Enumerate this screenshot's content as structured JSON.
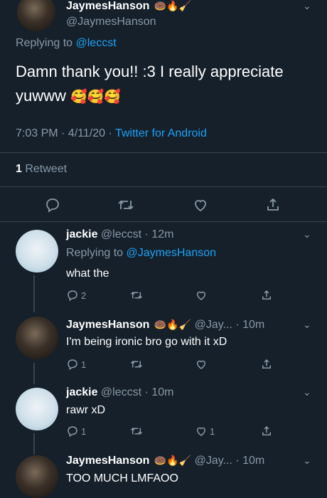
{
  "main_tweet": {
    "name": "JaymesHanson",
    "name_emojis": "🍩🔥🧹",
    "handle": "@JaymesHanson",
    "replying_prefix": "Replying to ",
    "replying_to": "@leccst",
    "text": "Damn thank you!!  :3 I really appreciate yuwww",
    "text_emojis": "🥰🥰🥰",
    "time": "7:03 PM · 4/11/20 · ",
    "client": "Twitter for Android",
    "retweet_count": "1",
    "retweet_label": " Retweet"
  },
  "replies": [
    {
      "name": "jackie",
      "name_emojis": "",
      "handle_time": " @leccst · 12m",
      "replying_prefix": "Replying to ",
      "replying_to": "@JaymesHanson",
      "text": "what the",
      "reply_count": "2",
      "like_count": ""
    },
    {
      "name": "JaymesHanson",
      "name_emojis": "🍩🔥🧹",
      "handle_time": " @Jay... · 10m",
      "text": "I'm being ironic bro go with it xD",
      "reply_count": "1",
      "like_count": ""
    },
    {
      "name": "jackie",
      "name_emojis": "",
      "handle_time": " @leccst · 10m",
      "text": "rawr xD",
      "reply_count": "1",
      "like_count": "1"
    },
    {
      "name": "JaymesHanson",
      "name_emojis": "🍩🔥🧹",
      "handle_time": " @Jay... · 10m",
      "text": "TOO MUCH LMFAOO"
    }
  ],
  "icons": [
    "reply-icon",
    "retweet-icon",
    "like-icon",
    "share-icon",
    "chevron-down-icon"
  ],
  "colors": {
    "background": "#15202b",
    "accent": "#1da1f2",
    "muted": "#8899a6",
    "divider": "#38444d"
  }
}
